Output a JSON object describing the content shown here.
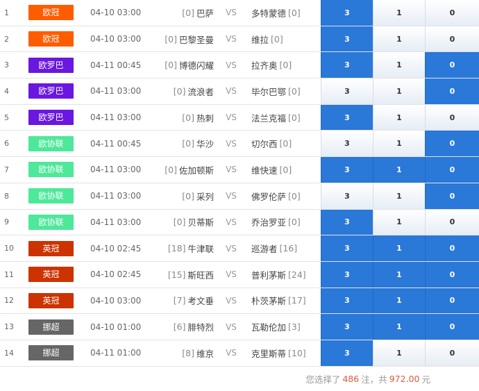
{
  "league_colors": {
    "欧冠": "#ff5c00",
    "欧罗巴": "#6a17e0",
    "欧协联": "#4de89a",
    "英冠": "#cc3300",
    "挪超": "#666666"
  },
  "matches": [
    {
      "idx": "1",
      "league": "欧冠",
      "time": "04-10 03:00",
      "home_rank": "[0]",
      "home": "巴萨",
      "vs": "VS",
      "away": "多特蒙德",
      "away_rank": "[0]",
      "options": [
        {
          "label": "3",
          "selected": true
        },
        {
          "label": "1",
          "selected": false
        },
        {
          "label": "0",
          "selected": false
        }
      ]
    },
    {
      "idx": "2",
      "league": "欧冠",
      "time": "04-10 03:00",
      "home_rank": "[0]",
      "home": "巴黎圣曼",
      "vs": "VS",
      "away": "维拉",
      "away_rank": "[0]",
      "options": [
        {
          "label": "3",
          "selected": true
        },
        {
          "label": "1",
          "selected": false
        },
        {
          "label": "0",
          "selected": false
        }
      ]
    },
    {
      "idx": "3",
      "league": "欧罗巴",
      "time": "04-11 00:45",
      "home_rank": "[0]",
      "home": "博德闪耀",
      "vs": "VS",
      "away": "拉齐奥",
      "away_rank": "[0]",
      "options": [
        {
          "label": "3",
          "selected": true
        },
        {
          "label": "1",
          "selected": false
        },
        {
          "label": "0",
          "selected": true
        }
      ]
    },
    {
      "idx": "4",
      "league": "欧罗巴",
      "time": "04-11 03:00",
      "home_rank": "[0]",
      "home": "流浪者",
      "vs": "VS",
      "away": "毕尔巴鄂",
      "away_rank": "[0]",
      "options": [
        {
          "label": "3",
          "selected": false
        },
        {
          "label": "1",
          "selected": false
        },
        {
          "label": "0",
          "selected": true
        }
      ]
    },
    {
      "idx": "5",
      "league": "欧罗巴",
      "time": "04-11 03:00",
      "home_rank": "[0]",
      "home": "热刺",
      "vs": "VS",
      "away": "法兰克福",
      "away_rank": "[0]",
      "options": [
        {
          "label": "3",
          "selected": true
        },
        {
          "label": "1",
          "selected": false
        },
        {
          "label": "0",
          "selected": false
        }
      ]
    },
    {
      "idx": "6",
      "league": "欧协联",
      "time": "04-11 00:45",
      "home_rank": "[0]",
      "home": "华沙",
      "vs": "VS",
      "away": "切尔西",
      "away_rank": "[0]",
      "options": [
        {
          "label": "3",
          "selected": false
        },
        {
          "label": "1",
          "selected": false
        },
        {
          "label": "0",
          "selected": true
        }
      ]
    },
    {
      "idx": "7",
      "league": "欧协联",
      "time": "04-11 03:00",
      "home_rank": "[0]",
      "home": "佐加顿斯",
      "vs": "VS",
      "away": "维快速",
      "away_rank": "[0]",
      "options": [
        {
          "label": "3",
          "selected": true
        },
        {
          "label": "1",
          "selected": true
        },
        {
          "label": "0",
          "selected": true
        }
      ]
    },
    {
      "idx": "8",
      "league": "欧协联",
      "time": "04-11 03:00",
      "home_rank": "[0]",
      "home": "采列",
      "vs": "VS",
      "away": "佛罗伦萨",
      "away_rank": "[0]",
      "options": [
        {
          "label": "3",
          "selected": false
        },
        {
          "label": "1",
          "selected": false
        },
        {
          "label": "0",
          "selected": true
        }
      ]
    },
    {
      "idx": "9",
      "league": "欧协联",
      "time": "04-11 03:00",
      "home_rank": "[0]",
      "home": "贝蒂斯",
      "vs": "VS",
      "away": "乔治罗亚",
      "away_rank": "[0]",
      "options": [
        {
          "label": "3",
          "selected": true
        },
        {
          "label": "1",
          "selected": false
        },
        {
          "label": "0",
          "selected": false
        }
      ]
    },
    {
      "idx": "10",
      "league": "英冠",
      "time": "04-10 02:45",
      "home_rank": "[18]",
      "home": "牛津联",
      "vs": "VS",
      "away": "巡游者",
      "away_rank": "[16]",
      "options": [
        {
          "label": "3",
          "selected": true
        },
        {
          "label": "1",
          "selected": true
        },
        {
          "label": "0",
          "selected": true
        }
      ]
    },
    {
      "idx": "11",
      "league": "英冠",
      "time": "04-10 02:45",
      "home_rank": "[15]",
      "home": "斯旺西",
      "vs": "VS",
      "away": "普利茅斯",
      "away_rank": "[24]",
      "options": [
        {
          "label": "3",
          "selected": true
        },
        {
          "label": "1",
          "selected": true
        },
        {
          "label": "0",
          "selected": true
        }
      ]
    },
    {
      "idx": "12",
      "league": "英冠",
      "time": "04-10 03:00",
      "home_rank": "[7]",
      "home": "考文垂",
      "vs": "VS",
      "away": "朴茨茅斯",
      "away_rank": "[17]",
      "options": [
        {
          "label": "3",
          "selected": true
        },
        {
          "label": "1",
          "selected": true
        },
        {
          "label": "0",
          "selected": true
        }
      ]
    },
    {
      "idx": "13",
      "league": "挪超",
      "time": "04-10 01:00",
      "home_rank": "[6]",
      "home": "腓特烈",
      "vs": "VS",
      "away": "瓦勒伦加",
      "away_rank": "[3]",
      "options": [
        {
          "label": "3",
          "selected": true
        },
        {
          "label": "1",
          "selected": true
        },
        {
          "label": "0",
          "selected": true
        }
      ]
    },
    {
      "idx": "14",
      "league": "挪超",
      "time": "04-11 01:00",
      "home_rank": "[8]",
      "home": "维京",
      "vs": "VS",
      "away": "克里斯蒂",
      "away_rank": "[10]",
      "options": [
        {
          "label": "3",
          "selected": true
        },
        {
          "label": "1",
          "selected": false
        },
        {
          "label": "0",
          "selected": false
        }
      ]
    }
  ],
  "footer": {
    "prefix": "您选择了",
    "count": "486",
    "mid": "注，共",
    "amount": "972.00",
    "suffix": "元"
  }
}
